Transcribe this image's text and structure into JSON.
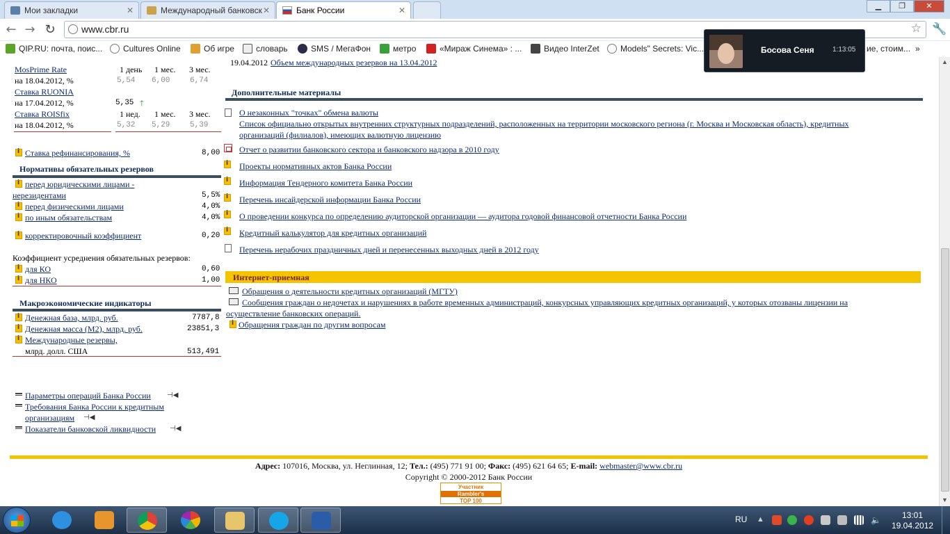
{
  "browser": {
    "tabs": [
      {
        "label": "Мои закладки",
        "favicon": "vk-icon"
      },
      {
        "label": "Международный банковск",
        "favicon": "bank-icon"
      },
      {
        "label": "Банк России",
        "favicon": "cbr-icon"
      }
    ],
    "url": "www.cbr.ru",
    "bookmarks": [
      "QIP.RU: почта, поис...",
      "Cultures Online",
      "Об игре",
      "словарь",
      "SMS / МегаФон",
      "метро",
      "«Мираж Синема» : ...",
      "Видео InterZet",
      "Models\" Secrets: Vic...",
      "ие, стоим..."
    ]
  },
  "popup": {
    "name": "Босова Сеня",
    "time": "1:13:05"
  },
  "rates": {
    "mosprime": {
      "label": "MosPrime Rate",
      "date": "на 18.04.2012, %",
      "h1": "1 день",
      "h2": "1 мес.",
      "h3": "3 мес.",
      "v1": "5,54",
      "v2": "6,00",
      "v3": "6,74"
    },
    "ruonia": {
      "label": "Ставка RUONIA",
      "date": "на 17.04.2012, %",
      "v1": "5,35",
      "arrow": "up"
    },
    "roisfix": {
      "label": "Ставка ROISfix",
      "date": "на 18.04.2012, %",
      "h1": "1 нед.",
      "h2": "1 мес.",
      "h3": "3 мес.",
      "v1": "5,32",
      "v2": "5,29",
      "v3": "5,39"
    }
  },
  "refin": {
    "label": "Ставка рефинансирования, %",
    "value": "8,00"
  },
  "reserves": {
    "title": "Нормативы обязательных резервов",
    "items": [
      {
        "label1": "перед юридическими лицами -",
        "label2": "нерезидентами",
        "value": "5,5%"
      },
      {
        "label1": "перед физическими лицами",
        "value": "4,0%"
      },
      {
        "label1": "по иным обязательствам",
        "value": "4,0%"
      },
      {
        "label1": "корректировочный коэффициент",
        "value": "0,20"
      }
    ],
    "avg_title": "Коэффициент усреднения обязательных резервов:",
    "avg": [
      {
        "label": "для КО",
        "value": "0,60"
      },
      {
        "label": "для НКО",
        "value": "1,00"
      }
    ]
  },
  "macro": {
    "title": "Макроэкономические индикаторы",
    "items": [
      {
        "label1": "Денежная база, млрд. руб.",
        "value": "7787,8"
      },
      {
        "label1": "Денежная масса (М2), млрд. руб.",
        "value": "23851,3"
      },
      {
        "label1": "Международные резервы,",
        "label2": "млрд. долл. США",
        "value": "513,491"
      }
    ]
  },
  "left_links": [
    {
      "label1": "Параметры операций Банка России"
    },
    {
      "label1": "Требования Банка России к кредитным",
      "label2": "организациям"
    },
    {
      "label1": "Показатели банковской ликвидности"
    }
  ],
  "news": {
    "date": "19.04.2012",
    "link": "Объем международных резервов на 13.04.2012"
  },
  "materials": {
    "title": "Дополнительные материалы",
    "items": [
      {
        "icon": "document-icon",
        "text": "О незаконных \"точках\" обмена валюты"
      },
      {
        "icon": "none",
        "text": "Список официально открытых внутренних структурных подразделений, расположенных на территории московского региона (г. Москва и Московская область), кредитных",
        "text2": "организаций (филиалов), имеющих валютную лицензию"
      },
      {
        "icon": "pdf-icon",
        "text": "Отчет о развитии банковского сектора и банковского надзора в 2010 году"
      },
      {
        "icon": "info-icon",
        "text": "Проекты нормативных актов Банка России"
      },
      {
        "icon": "info-icon",
        "text": "Информация Тендерного комитета Банка России"
      },
      {
        "icon": "info-icon",
        "text": "Перечень инсайдерской информации Банка России"
      },
      {
        "icon": "info-icon",
        "text": "О проведении конкурса по определению аудиторской организации — аудитора годовой финансовой отчетности Банка России"
      },
      {
        "icon": "info-icon",
        "text": "Кредитный калькулятор для кредитных организаций"
      },
      {
        "icon": "document-icon",
        "text": "Перечень нерабочих праздничных дней и перенесенных выходных дней в 2012 году"
      }
    ]
  },
  "reception": {
    "title": "Интернет-приемная",
    "items": [
      {
        "icon": "mail-icon",
        "text": "Обращения о деятельности кредитных организаций (МГТУ)"
      },
      {
        "icon": "mail-icon",
        "text": "Сообщения граждан о недочетах и нарушениях в работе временных администраций, конкурсных управляющих кредитных организаций, у которых отозваны лицензии на",
        "text2": "осуществление банковских операций."
      },
      {
        "icon": "info-icon",
        "text": "Обращения граждан по другим вопросам"
      }
    ]
  },
  "footer": {
    "addr_label": "Адрес:",
    "addr": "107016, Москва, ул. Неглинная, 12;",
    "tel_label": "Тел.:",
    "tel": "(495) 771 91 00;",
    "fax_label": "Факс:",
    "fax": "(495) 621 64 65;",
    "email_label": "E-mail:",
    "email": "webmaster@www.cbr.ru",
    "copyright": "Copyright © 2000-2012 Банк России",
    "rambler1": "Участник",
    "rambler2": "Rambler's",
    "rambler3": "TOP 100"
  },
  "taskbar": {
    "lang": "RU",
    "time": "13:01",
    "date": "19.04.2012"
  }
}
